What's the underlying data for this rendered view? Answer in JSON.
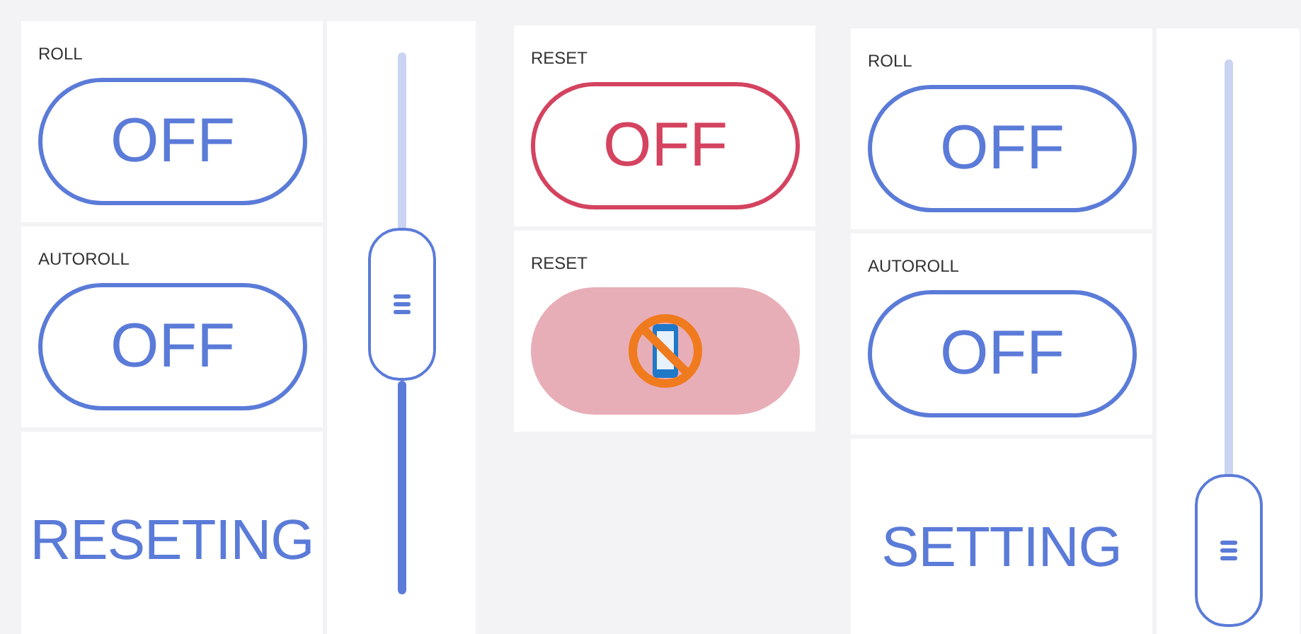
{
  "panels": [
    {
      "widgets": [
        {
          "kind": "toggle",
          "label": "ROLL",
          "text": "OFF",
          "color": "#5b7bd8"
        },
        {
          "kind": "toggle",
          "label": "AUTOROLL",
          "text": "OFF",
          "color": "#5b7bd8"
        },
        {
          "kind": "display",
          "text": "RESETING",
          "color": "#5b7bd8"
        }
      ],
      "slider": {
        "level": 0.53
      }
    },
    {
      "widgets": [
        {
          "kind": "toggle",
          "label": "RESET",
          "text": "OFF",
          "color": "#d4435f"
        },
        {
          "kind": "offline",
          "label": "RESET",
          "color": "#e8aeb8"
        }
      ]
    },
    {
      "widgets": [
        {
          "kind": "toggle",
          "label": "ROLL",
          "text": "OFF",
          "color": "#5b7bd8"
        },
        {
          "kind": "toggle",
          "label": "AUTOROLL",
          "text": "OFF",
          "color": "#5b7bd8"
        },
        {
          "kind": "display",
          "text": "SETTING",
          "color": "#5b7bd8"
        }
      ],
      "slider": {
        "level": 0.09
      }
    }
  ]
}
